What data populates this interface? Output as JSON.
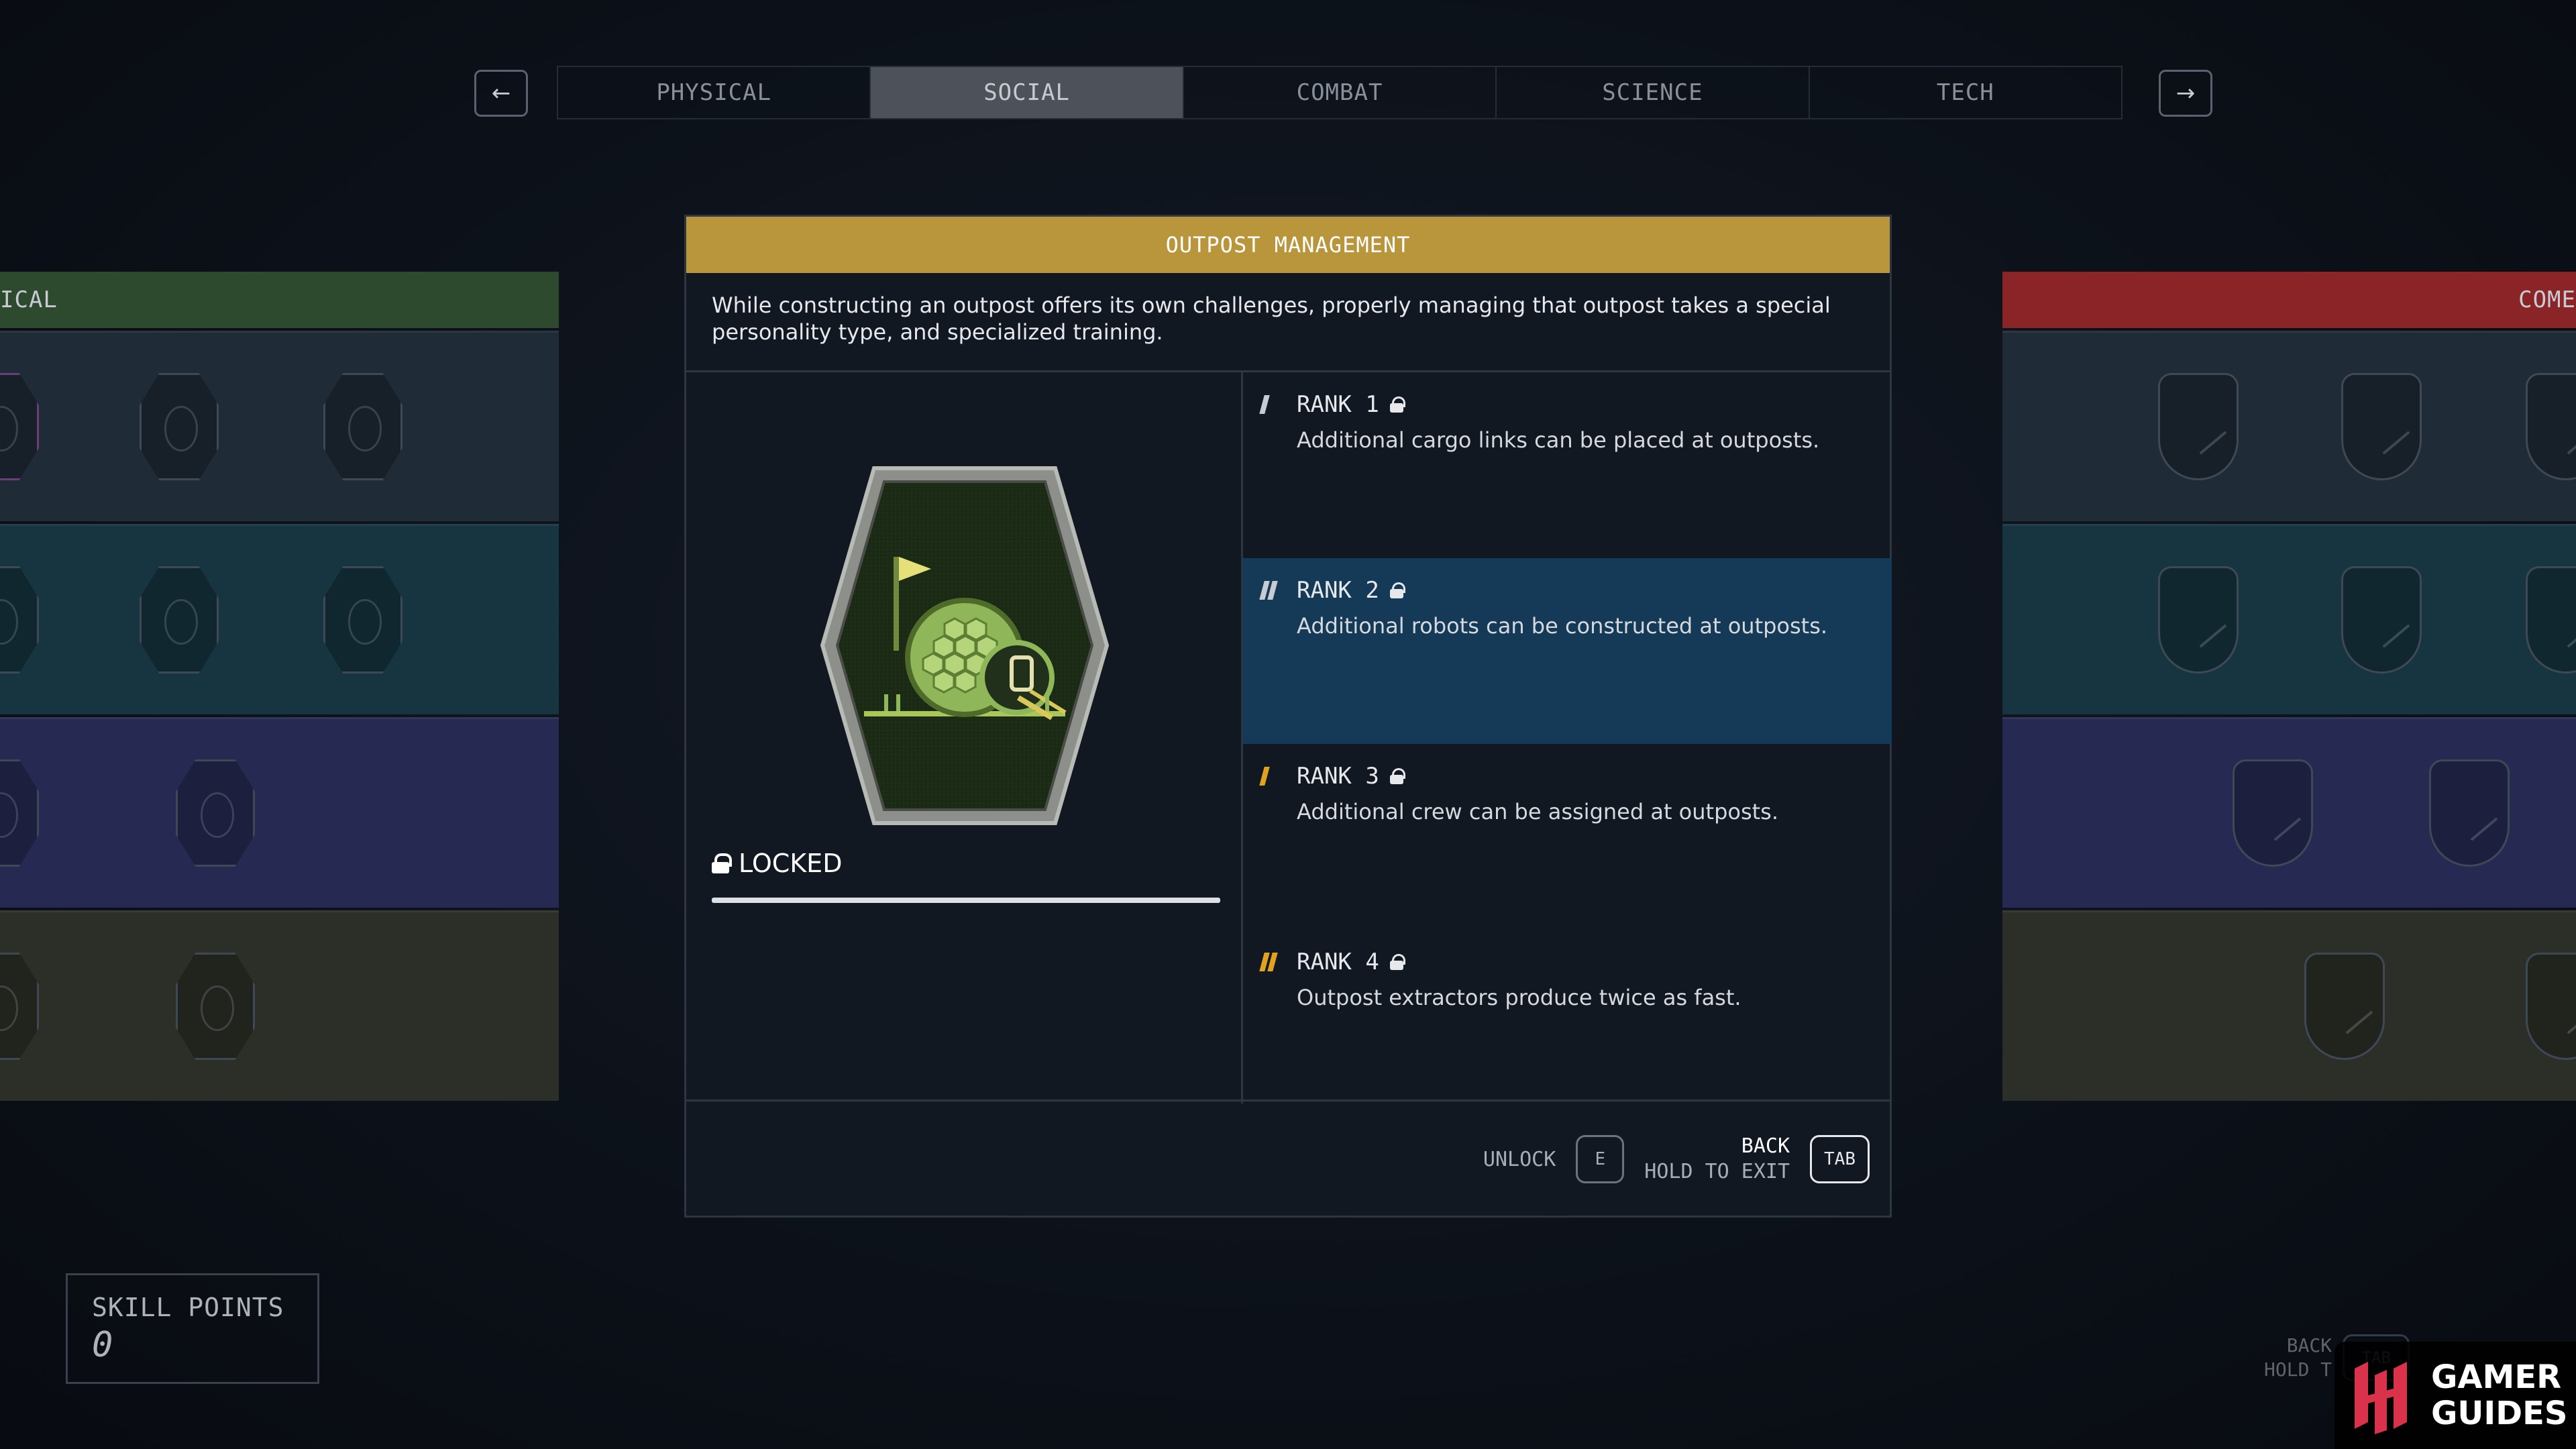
{
  "nav": {
    "prev_icon": "←",
    "next_icon": "→",
    "tabs": [
      {
        "label": "PHYSICAL",
        "active": false
      },
      {
        "label": "SOCIAL",
        "active": true
      },
      {
        "label": "COMBAT",
        "active": false
      },
      {
        "label": "SCIENCE",
        "active": false
      },
      {
        "label": "TECH",
        "active": false
      }
    ]
  },
  "left_column": {
    "header": "ICAL",
    "color": "#2d4a2e"
  },
  "right_column": {
    "header": "COME",
    "color": "#8b2426"
  },
  "skill": {
    "title": "OUTPOST MANAGEMENT",
    "description": "While constructing an outpost offers its own challenges, properly managing that outpost takes a special personality type, and specialized training.",
    "status": "LOCKED",
    "progress": 1.0,
    "ranks": [
      {
        "label": "RANK 1",
        "text": "Additional cargo links can be placed at outposts.",
        "locked": true,
        "marks": 1,
        "mark_color": "#c8ccd2"
      },
      {
        "label": "RANK 2",
        "text": "Additional robots can be constructed at outposts.",
        "locked": true,
        "marks": 2,
        "mark_color": "#c8ccd2"
      },
      {
        "label": "RANK 3",
        "text": "Additional crew can be assigned at outposts.",
        "locked": true,
        "marks": 1,
        "mark_color": "#e1a21f"
      },
      {
        "label": "RANK 4",
        "text": "Outpost extractors produce twice as fast.",
        "locked": true,
        "marks": 2,
        "mark_color": "#e1a21f"
      }
    ],
    "highlighted_rank": 2
  },
  "footer": {
    "unlock_label": "UNLOCK",
    "unlock_key": "E",
    "back_label": "BACK",
    "hold_label": "HOLD TO EXIT",
    "back_key": "TAB"
  },
  "skill_points": {
    "label": "SKILL POINTS",
    "value": "0"
  },
  "faded_hint": {
    "back_label": "BACK",
    "hold_label": "HOLD T",
    "key": "TAB"
  },
  "watermark": {
    "line1": "GAMER",
    "line2": "GUIDES"
  },
  "colors": {
    "accent": "#b9963c",
    "highlight": "#153a57",
    "rank_gold": "#e1a21f"
  }
}
